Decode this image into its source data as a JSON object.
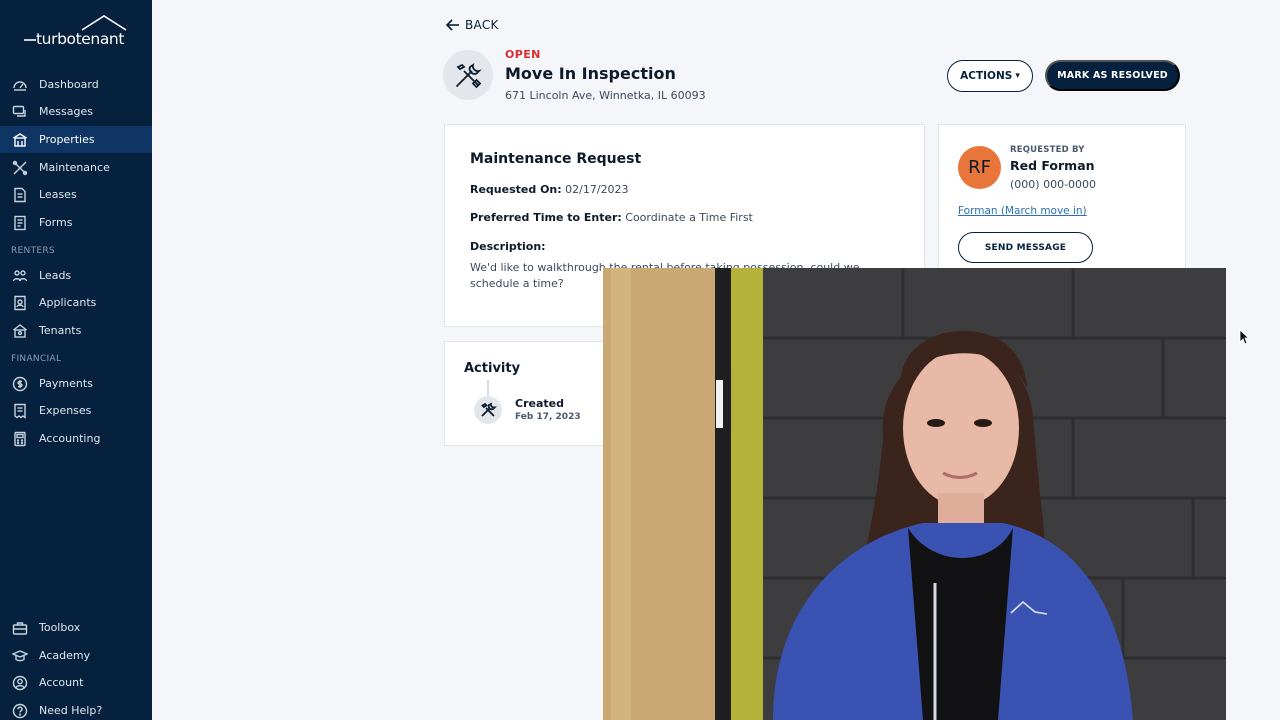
{
  "app": {
    "logo_text": "turbotenant"
  },
  "sidebar": {
    "items": [
      {
        "label": "Dashboard",
        "icon": "dashboard-icon",
        "active": false
      },
      {
        "label": "Messages",
        "icon": "messages-icon",
        "active": false
      },
      {
        "label": "Properties",
        "icon": "properties-icon",
        "active": true
      },
      {
        "label": "Maintenance",
        "icon": "maintenance-icon",
        "active": false
      },
      {
        "label": "Leases",
        "icon": "leases-icon",
        "active": false
      },
      {
        "label": "Forms",
        "icon": "forms-icon",
        "active": false
      }
    ],
    "renters_label": "RENTERS",
    "renters_items": [
      {
        "label": "Leads",
        "icon": "leads-icon"
      },
      {
        "label": "Applicants",
        "icon": "applicants-icon"
      },
      {
        "label": "Tenants",
        "icon": "tenants-icon"
      }
    ],
    "financial_label": "FINANCIAL",
    "financial_items": [
      {
        "label": "Payments",
        "icon": "payments-icon"
      },
      {
        "label": "Expenses",
        "icon": "expenses-icon"
      },
      {
        "label": "Accounting",
        "icon": "accounting-icon"
      }
    ],
    "bottom_items": [
      {
        "label": "Toolbox",
        "icon": "toolbox-icon"
      },
      {
        "label": "Academy",
        "icon": "academy-icon"
      },
      {
        "label": "Account",
        "icon": "account-icon"
      },
      {
        "label": "Need Help?",
        "icon": "help-icon"
      }
    ]
  },
  "header": {
    "back_label": "BACK",
    "status": "OPEN",
    "title": "Move In Inspection",
    "address": "671 Lincoln Ave, Winnetka, IL 60093",
    "actions_label": "ACTIONS",
    "resolve_label": "MARK AS RESOLVED"
  },
  "request": {
    "heading": "Maintenance Request",
    "requested_on_label": "Requested On:",
    "requested_on_value": "02/17/2023",
    "preferred_time_label": "Preferred Time to Enter:",
    "preferred_time_value": "Coordinate a Time First",
    "description_label": "Description:",
    "description_value": "We'd like to walkthrough the rental before taking possession, could we schedule a time?"
  },
  "activity": {
    "heading": "Activity",
    "entries": [
      {
        "title": "Created",
        "date": "Feb 17, 2023"
      }
    ]
  },
  "requester": {
    "label": "REQUESTED BY",
    "initials": "RF",
    "name": "Red Forman",
    "phone": "(000) 000-0000",
    "lease_link": "Forman (March move in)",
    "send_label": "SEND MESSAGE"
  },
  "colors": {
    "sidebar_bg": "#05213d",
    "active_item": "#0e3563",
    "status_open": "#d62e2e",
    "avatar": "#e8763a",
    "link": "#2a6fb5"
  }
}
